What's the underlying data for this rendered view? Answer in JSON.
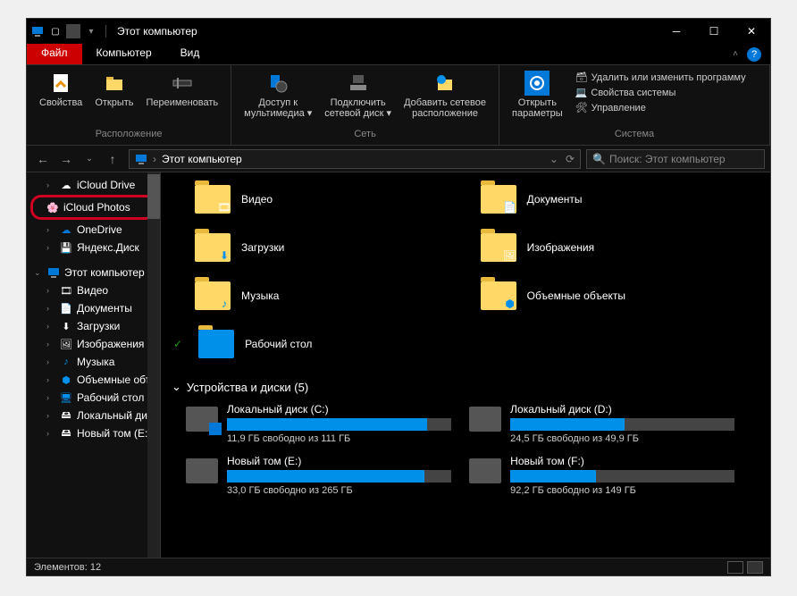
{
  "title": "Этот компьютер",
  "tabs": {
    "t0": "Файл",
    "t1": "Компьютер",
    "t2": "Вид"
  },
  "ribbon": {
    "g1": {
      "props": "Свойства",
      "open": "Открыть",
      "rename": "Переименовать",
      "label": "Расположение"
    },
    "g2": {
      "media": "Доступ к\nмультимедиа ▾",
      "map": "Подключить\nсетевой диск ▾",
      "addnet": "Добавить сетевое\nрасположение",
      "label": "Сеть"
    },
    "g3": {
      "settings": "Открыть\nпараметры",
      "uninstall": "Удалить или изменить программу",
      "sysprops": "Свойства системы",
      "manage": "Управление",
      "label": "Система"
    }
  },
  "breadcrumb": "Этот компьютер",
  "search_ph": "Поиск: Этот компьютер",
  "sidebar": {
    "icloud_drive": "iCloud Drive",
    "icloud_photos": "iCloud Photos",
    "onedrive": "OneDrive",
    "yandex": "Яндекс.Диск",
    "this_pc": "Этот компьютер",
    "videos": "Видео",
    "documents": "Документы",
    "downloads": "Загрузки",
    "pictures": "Изображения",
    "music": "Музыка",
    "objects": "Объемные объ",
    "desktop": "Рабочий стол",
    "localdisk": "Локальный дис",
    "newvol": "Новый том (E:"
  },
  "folders": {
    "videos": "Видео",
    "documents": "Документы",
    "downloads": "Загрузки",
    "pictures": "Изображения",
    "music": "Музыка",
    "objects": "Объемные объекты",
    "desktop": "Рабочий стол"
  },
  "section_disks": "Устройства и диски (5)",
  "disks": [
    {
      "name": "Локальный диск (C:)",
      "free": "11,9 ГБ свободно из 111 ГБ",
      "pct": 89
    },
    {
      "name": "Локальный диск (D:)",
      "free": "24,5 ГБ свободно из 49,9 ГБ",
      "pct": 51
    },
    {
      "name": "Новый том (E:)",
      "free": "33,0 ГБ свободно из 265 ГБ",
      "pct": 88
    },
    {
      "name": "Новый том (F:)",
      "free": "92,2 ГБ свободно из 149 ГБ",
      "pct": 38
    }
  ],
  "status": "Элементов: 12"
}
